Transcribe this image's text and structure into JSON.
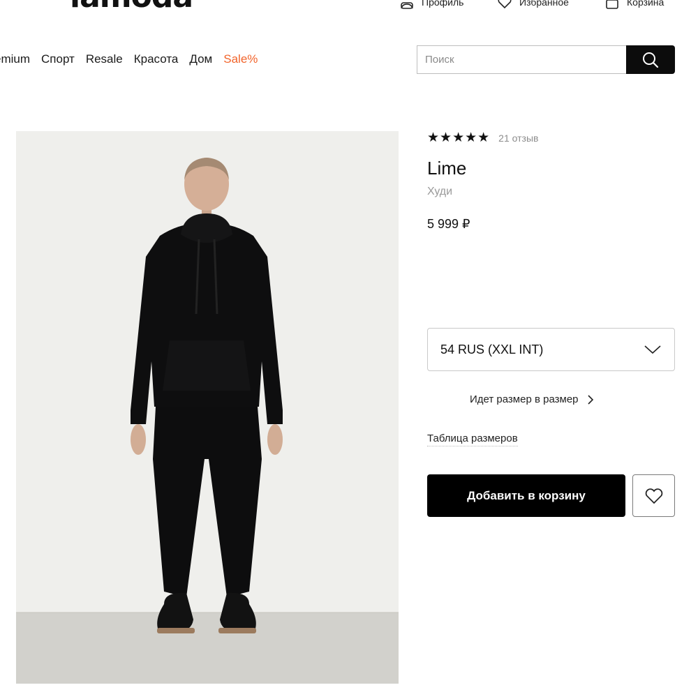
{
  "header": {
    "logo_text": "lamoda",
    "utility": [
      {
        "label": "Профиль",
        "icon": "profile-icon"
      },
      {
        "label": "Избранное",
        "icon": "heart-icon"
      },
      {
        "label": "Корзина",
        "icon": "cart-icon"
      }
    ]
  },
  "nav": {
    "items": [
      "emium",
      "Спорт",
      "Resale",
      "Красота",
      "Дом"
    ],
    "sale": "Sale%"
  },
  "search": {
    "placeholder": "Поиск",
    "button_icon": "search-icon"
  },
  "product": {
    "stars": "★★★★★",
    "rating_value": 5,
    "reviews": "21 отзыв",
    "brand": "Lime",
    "category": "Худи",
    "price": "5 999 ₽",
    "size_selected": "54 RUS (XXL INT)",
    "fit_text": "Идет размер в размер",
    "size_table_link": "Таблица размеров",
    "add_to_cart": "Добавить в корзину"
  },
  "colors": {
    "accent_sale": "#f2642b",
    "button_dark": "#000000",
    "photo_bg": "#eeeeeb"
  }
}
